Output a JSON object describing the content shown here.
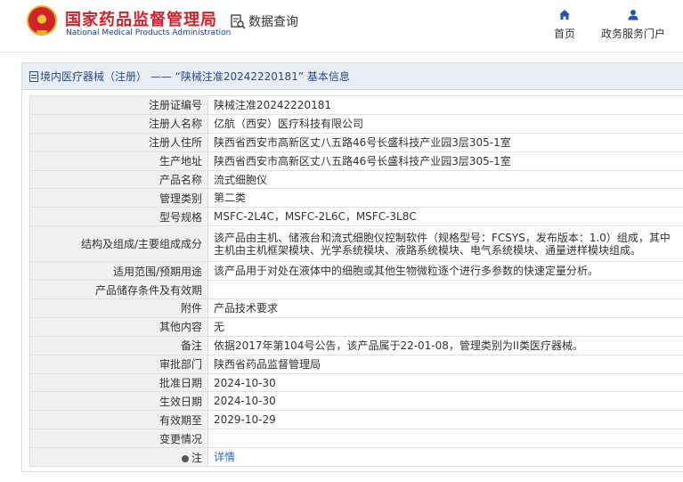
{
  "header": {
    "brand_cn": "国家药品监督管理局",
    "brand_en": "National Medical Products Administration",
    "query_label": "数据查询",
    "nav": [
      {
        "label": "首页",
        "icon": "home-icon"
      },
      {
        "label": "政务服务门户",
        "icon": "user-icon"
      }
    ]
  },
  "colors": {
    "brand_red": "#d4202a",
    "brand_blue": "#1a3f8e",
    "link_blue": "#2a6ab8",
    "title_bar": "#e9eef4"
  },
  "panel": {
    "title": "境内医疗器械（注册） ——  “陕械注准20242220181” 基本信息"
  },
  "rows": [
    {
      "label": "注册证编号",
      "value": "陕械注准20242220181"
    },
    {
      "label": "注册人名称",
      "value": "亿航（西安）医疗科技有限公司"
    },
    {
      "label": "注册人住所",
      "value": "陕西省西安市高新区丈八五路46号长盛科技产业园3层305-1室"
    },
    {
      "label": "生产地址",
      "value": "陕西省西安市高新区丈八五路46号长盛科技产业园3层305-1室"
    },
    {
      "label": "产品名称",
      "value": "流式细胞仪"
    },
    {
      "label": "管理类别",
      "value": "第二类"
    },
    {
      "label": "型号规格",
      "value": "MSFC-2L4C，MSFC-2L6C，MSFC-3L8C"
    },
    {
      "label": "结构及组成/主要组成成分",
      "value": "该产品由主机、储液台和流式细胞仪控制软件（规格型号：FCSYS，发布版本：1.0）组成，其中主机由主机框架模块、光学系统模块、液路系统模块、电气系统模块、通量进样模块组成。",
      "tall": true
    },
    {
      "label": "适用范围/预期用途",
      "value": "该产品用于对处在液体中的细胞或其他生物微粒逐个进行多参数的快速定量分析。"
    },
    {
      "label": "产品储存条件及有效期",
      "value": ""
    },
    {
      "label": "附件",
      "value": "产品技术要求"
    },
    {
      "label": "其他内容",
      "value": "无"
    },
    {
      "label": "备注",
      "value": "依据2017年第104号公告，该产品属于22-01-08，管理类别为II类医疗器械。"
    },
    {
      "label": "审批部门",
      "value": "陕西省药品监督管理局"
    },
    {
      "label": "批准日期",
      "value": "2024-10-30"
    },
    {
      "label": "生效日期",
      "value": "2024-10-30"
    },
    {
      "label": "有效期至",
      "value": "2029-10-29"
    },
    {
      "label": "变更情况",
      "value": ""
    }
  ],
  "note_row": {
    "label": "注",
    "link": "详情"
  }
}
